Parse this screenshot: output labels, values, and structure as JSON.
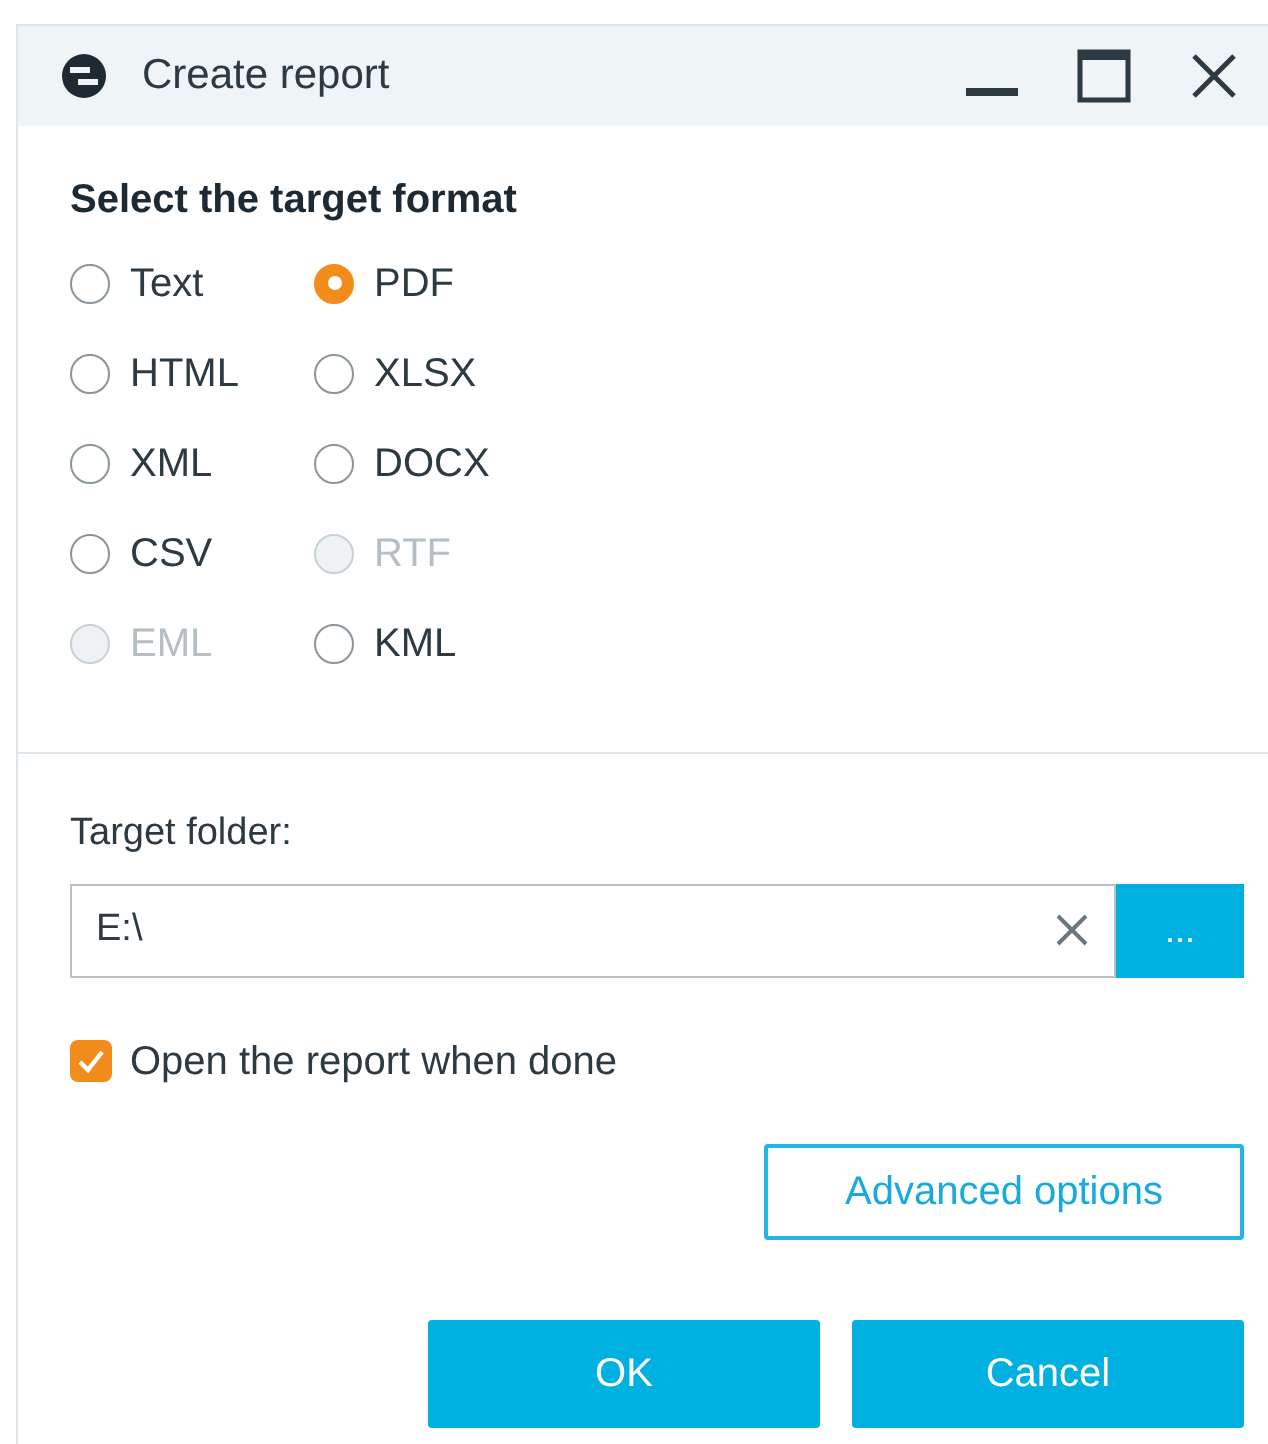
{
  "window": {
    "title": "Create report"
  },
  "format_section": {
    "heading": "Select the target format",
    "formats": [
      {
        "label": "Text",
        "selected": false,
        "disabled": false
      },
      {
        "label": "PDF",
        "selected": true,
        "disabled": false
      },
      {
        "label": "HTML",
        "selected": false,
        "disabled": false
      },
      {
        "label": "XLSX",
        "selected": false,
        "disabled": false
      },
      {
        "label": "XML",
        "selected": false,
        "disabled": false
      },
      {
        "label": "DOCX",
        "selected": false,
        "disabled": false
      },
      {
        "label": "CSV",
        "selected": false,
        "disabled": false
      },
      {
        "label": "RTF",
        "selected": false,
        "disabled": true
      },
      {
        "label": "EML",
        "selected": false,
        "disabled": true
      },
      {
        "label": "KML",
        "selected": false,
        "disabled": false
      }
    ]
  },
  "target_folder": {
    "label": "Target folder:",
    "value": "E:\\",
    "browse_label": "..."
  },
  "open_when_done": {
    "label": "Open the report when done",
    "checked": true
  },
  "buttons": [
    "Advanced options",
    "OK",
    "Cancel"
  ]
}
